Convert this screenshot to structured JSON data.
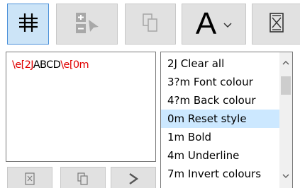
{
  "toolbar": {
    "grid_button": {
      "icon": "hash-grid-icon",
      "state": "selected"
    },
    "plus_minus_button": {
      "icon": "plus-minus-cursor-icon",
      "state": "disabled"
    },
    "copy_button": {
      "icon": "copy-icon",
      "state": "disabled"
    },
    "font_button": {
      "label": "A",
      "icon": "chevron-down-icon"
    },
    "clear_button": {
      "icon": "clear-icon"
    }
  },
  "editor": {
    "segments": [
      {
        "text": "\\e[2J",
        "kind": "escape"
      },
      {
        "text": "ABCD",
        "kind": "text"
      },
      {
        "text": "\\e[0m",
        "kind": "escape"
      }
    ],
    "escape_color": "#e00000"
  },
  "codes": {
    "items": [
      {
        "label": "2J Clear all"
      },
      {
        "label": "3?m Font colour"
      },
      {
        "label": "4?m Back colour"
      },
      {
        "label": "0m Reset style",
        "selected": true
      },
      {
        "label": "1m Bold"
      },
      {
        "label": "4m Underline"
      },
      {
        "label": "7m Invert colours"
      }
    ],
    "selected_color": "#cce8ff"
  },
  "bottom_buttons": {
    "clear": {
      "icon": "clear-icon"
    },
    "copy": {
      "icon": "copy-icon"
    },
    "insert": {
      "icon": "chevron-right-icon"
    }
  }
}
